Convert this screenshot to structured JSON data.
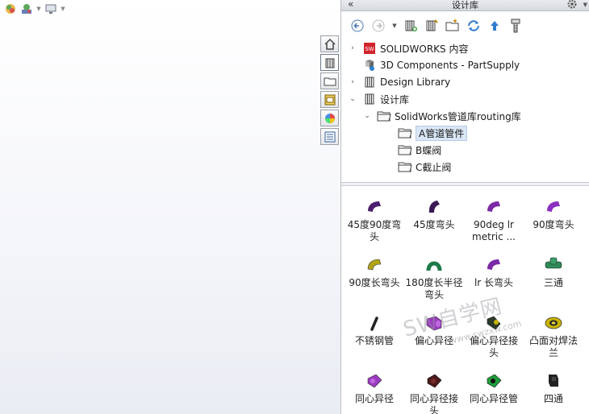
{
  "task_pane": {
    "title": "设计库",
    "collapse_glyph": "«",
    "gear_caret": "▼",
    "tree": [
      {
        "label": "SOLIDWORKS 内容",
        "chevron": "›",
        "icon": "solidworks-content-icon"
      },
      {
        "label": "3D Components - PartSupply",
        "chevron": "",
        "icon": "3d-components-icon"
      },
      {
        "label": "Design Library",
        "chevron": "›",
        "icon": "design-library-icon"
      },
      {
        "label": "设计库",
        "chevron": "⌄",
        "icon": "design-library-icon"
      },
      {
        "label": "SolidWorks管道库routing库",
        "chevron": "⌄",
        "icon": "folder-icon"
      },
      {
        "label": "A管道管件",
        "chevron": "",
        "icon": "folder-icon"
      },
      {
        "label": "B蝶阀",
        "chevron": "",
        "icon": "folder-icon"
      },
      {
        "label": "C截止阀",
        "chevron": "",
        "icon": "folder-icon"
      }
    ],
    "items": [
      {
        "line1": "45度90度弯",
        "line2": "头",
        "color": "#4b1f6e"
      },
      {
        "line1": "45度弯头",
        "line2": "",
        "color": "#3a1a55"
      },
      {
        "line1": "90deg lr",
        "line2": "metric ...",
        "color": "#7a2aa6"
      },
      {
        "line1": "90度弯头",
        "line2": "",
        "color": "#8a2fbf"
      },
      {
        "line1": "90度长弯头",
        "line2": "",
        "color": "#b2a417"
      },
      {
        "line1": "180度长半径",
        "line2": "弯头",
        "color": "#1f7a48"
      },
      {
        "line1": "lr 长弯头",
        "line2": "",
        "color": "#7a2aa6"
      },
      {
        "line1": "三通",
        "line2": "",
        "color": "#2e8b57"
      },
      {
        "line1": "不锈钢管",
        "line2": "",
        "color": "#222222"
      },
      {
        "line1": "偏心异径",
        "line2": "",
        "color": "#9b3bc0"
      },
      {
        "line1": "偏心异径接",
        "line2": "头",
        "color": "#2a3a2a"
      },
      {
        "line1": "凸面对焊法",
        "line2": "兰",
        "color": "#c9b400"
      },
      {
        "line1": "同心异径",
        "line2": "",
        "color": "#9b3bc0"
      },
      {
        "line1": "同心异径接",
        "line2": "头",
        "color": "#4a1a1a"
      },
      {
        "line1": "同心异径管",
        "line2": "",
        "color": "#1e9e3a"
      },
      {
        "line1": "四通",
        "line2": "",
        "color": "#222222"
      }
    ]
  },
  "watermark": {
    "text": "SW自学网",
    "url": "www.swzxw.com"
  }
}
